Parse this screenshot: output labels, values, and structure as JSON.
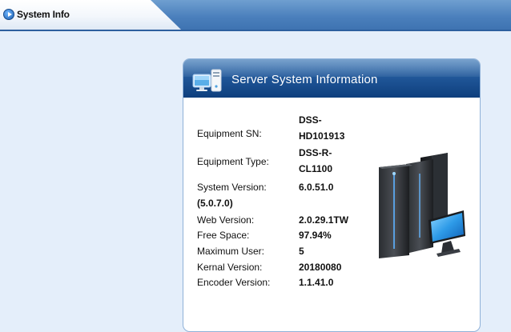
{
  "tab": {
    "label": "System Info"
  },
  "panel": {
    "title": "Server System Information"
  },
  "info": {
    "equipment_sn_label": "Equipment SN:",
    "equipment_sn_value_line1": "DSS-",
    "equipment_sn_value_line2": "HD101913",
    "equipment_type_label": "Equipment Type:",
    "equipment_type_value_line1": "DSS-R-",
    "equipment_type_value_line2": "CL1100",
    "system_version_label": "System Version:",
    "system_version_value": "6.0.51.0",
    "system_version_sub": "(5.0.7.0)",
    "web_version_label": "Web Version:",
    "web_version_value": "2.0.29.1TW",
    "free_space_label": "Free Space:",
    "free_space_value": "97.94%",
    "maximum_user_label": "Maximum User:",
    "maximum_user_value": "5",
    "kernal_version_label": "Kernal Version:",
    "kernal_version_value": "20180080",
    "encoder_version_label": "Encoder Version:",
    "encoder_version_value": "1.1.41.0"
  },
  "icons": {
    "tab_icon": "play-circle-icon",
    "header_icon": "computer-icon",
    "server_image": "server-rack-monitor-icon"
  },
  "colors": {
    "page_background": "#e4eefa",
    "header_blue": "#1f5597",
    "tab_bar_blue": "#4a7fbc"
  }
}
